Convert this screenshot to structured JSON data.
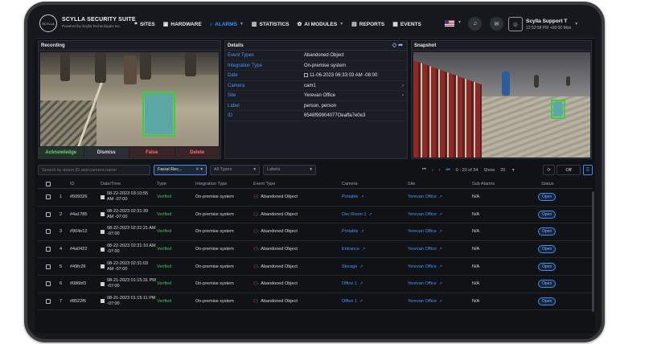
{
  "brand": {
    "logo_text": "SCYLLA",
    "title": "SCYLLA SECURITY SUITE",
    "subtitle": "Powered by Scylla Technologies Inc."
  },
  "nav": {
    "items": [
      {
        "label": "SITES",
        "icon": "pin-icon"
      },
      {
        "label": "HARDWARE",
        "icon": "camera-icon"
      },
      {
        "label": "ALARMS",
        "icon": "bell-icon",
        "active": true
      },
      {
        "label": "STATISTICS",
        "icon": "bar-chart-icon"
      },
      {
        "label": "AI MODULES",
        "icon": "brain-icon"
      },
      {
        "label": "REPORTS",
        "icon": "report-icon"
      },
      {
        "label": "EVENTS",
        "icon": "calendar-icon"
      }
    ]
  },
  "user": {
    "name": "Scylla Support T",
    "time": "12:52:58 PM +00:00 Mon"
  },
  "panels": {
    "recording": "Recording",
    "details": "Details",
    "snapshot": "Snapshot"
  },
  "details": [
    {
      "label": "Event Types",
      "value": "Abandoned Object"
    },
    {
      "label": "Integration Type",
      "value": "On-premise system"
    },
    {
      "label": "Date",
      "value": "11-06-2023 06:33:03 AM -08:00"
    },
    {
      "label": "Camera",
      "value": "cam1"
    },
    {
      "label": "Site",
      "value": "Yerevan Office"
    },
    {
      "label": "Label",
      "value": "person, person"
    },
    {
      "label": "ID",
      "value": "6548f99904077Oeaffa7e0e3"
    }
  ],
  "actions": {
    "acknowledge": "Acknowledge",
    "dismiss": "Dismiss",
    "false": "False",
    "delete": "Delete"
  },
  "filters": {
    "search_placeholder": "Search by alarm ID and camera name",
    "facial": "Facial Rec...",
    "types": "All Types",
    "labels": "Labels",
    "range": "0 - 20 of 34",
    "show_label": "Show",
    "show_value": "20",
    "off": "Off"
  },
  "table": {
    "headers": [
      "ID",
      "Date/Time",
      "Type",
      "Integration Type",
      "Event Type",
      "Camera",
      "Site",
      "Sub Alarms",
      "Status"
    ],
    "rows": [
      {
        "n": "1",
        "id": "#509326",
        "date": "08-22-2023 03:10:55",
        "tz": "AM -07:00",
        "type": "Verified",
        "integration": "On-premise system",
        "event": "Abandoned Object",
        "camera": "Portable",
        "site": "Yerevan Office",
        "sub": "N/A",
        "status": "Open"
      },
      {
        "n": "2",
        "id": "#4a1785",
        "date": "08-22-2023 02:31:39",
        "tz": "AM -07:00",
        "type": "Verified",
        "integration": "On-premise system",
        "event": "Abandoned Object",
        "camera": "Dev Room 1",
        "site": "Yerevan Office",
        "sub": "N/A",
        "status": "Open"
      },
      {
        "n": "3",
        "id": "#904e12",
        "date": "08-22-2023 02:31:21 AM",
        "tz": "-07:00",
        "type": "Verified",
        "integration": "On-premise system",
        "event": "Abandoned Object",
        "camera": "Portable",
        "site": "Yerevan Office",
        "sub": "N/A",
        "status": "Open"
      },
      {
        "n": "4",
        "id": "#4a0422",
        "date": "08-22-2023 02:31:10 AM",
        "tz": "-07:00",
        "type": "Verified",
        "integration": "On-premise system",
        "event": "Abandoned Object",
        "camera": "Entrance",
        "site": "Yerevan Office",
        "sub": "N/A",
        "status": "Open"
      },
      {
        "n": "5",
        "id": "#49fc26",
        "date": "08-22-2023 02:31:03",
        "tz": "AM -07:00",
        "type": "Verified",
        "integration": "On-premise system",
        "event": "Abandoned Object",
        "camera": "Storage",
        "site": "Yerevan Office",
        "sub": "N/A",
        "status": "Open"
      },
      {
        "n": "6",
        "id": "#086bf3",
        "date": "08-21-2023 01:15:31 PM",
        "tz": "-07:00",
        "type": "Verified",
        "integration": "On-premise system",
        "event": "Abandoned Object",
        "camera": "Office 1",
        "site": "Yerevan Office",
        "sub": "N/A",
        "status": "Open"
      },
      {
        "n": "7",
        "id": "#8522f6",
        "date": "08-21-2023 01:15:11 PM",
        "tz": "-07:00",
        "type": "Verified",
        "integration": "On-premise system",
        "event": "Abandoned Object",
        "camera": "Office 1",
        "site": "Yerevan Office",
        "sub": "N/A",
        "status": "Open"
      }
    ]
  },
  "colors": {
    "accent": "#3f8ef5",
    "verified": "#44c25a",
    "danger": "#ff6b6b",
    "detection_box": "#36d13d"
  }
}
